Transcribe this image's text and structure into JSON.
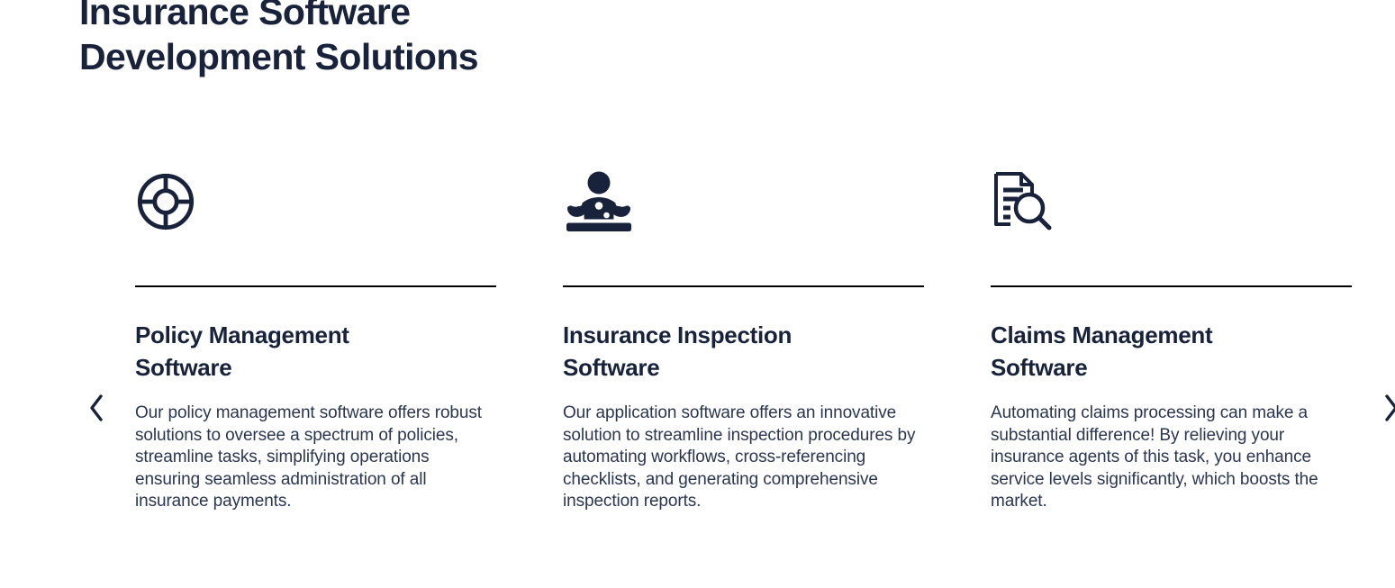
{
  "heading": "Insurance Software\nDevelopment Solutions",
  "carousel": {
    "prev_label": "Previous",
    "next_label": "Next",
    "prev_icon": "chevron-left-icon",
    "next_icon": "chevron-right-icon",
    "cards": [
      {
        "icon": "lifebuoy-icon",
        "title": "Policy Management\nSoftware",
        "body": "Our policy management software offers robust solutions to oversee a spectrum of policies, streamline tasks, simplifying operations ensuring seamless administration of all insurance payments."
      },
      {
        "icon": "inspector-person-icon",
        "title": "Insurance Inspection\nSoftware",
        "body": "Our application software offers an innovative solution to streamline inspection procedures by automating workflows, cross-referencing checklists, and generating comprehensive inspection reports."
      },
      {
        "icon": "document-search-icon",
        "title": "Claims Management\nSoftware",
        "body": "Automating claims processing can make a substantial difference! By relieving your insurance agents of this task, you enhance service levels significantly, which boosts the market."
      }
    ]
  },
  "colors": {
    "text_dark": "#18233b",
    "body_text": "#2a3650",
    "divider": "#000000",
    "background": "#ffffff"
  }
}
